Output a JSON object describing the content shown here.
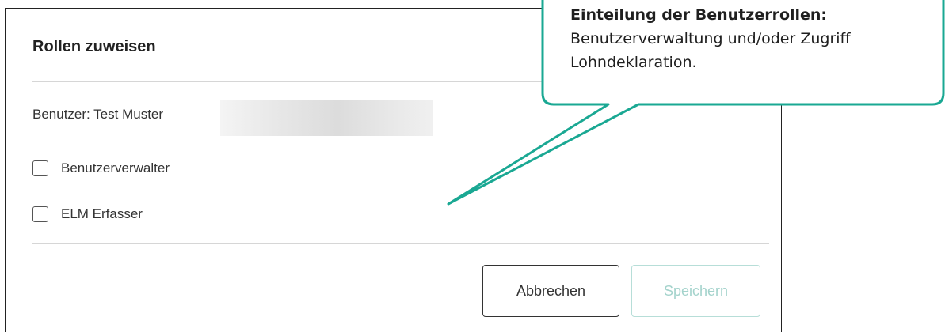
{
  "dialog": {
    "title": "Rollen zuweisen",
    "user_text": "Benutzer: Test Muster",
    "roles": [
      {
        "label": "Benutzerverwalter",
        "checked": false
      },
      {
        "label": "ELM Erfasser",
        "checked": false
      }
    ],
    "cancel_label": "Abbrechen",
    "save_label": "Speichern"
  },
  "callout": {
    "heading": "Einteilung der Benutzerrollen:",
    "line1": "Benutzerverwaltung und/oder Zugriff",
    "line2": "Lohndeklaration.",
    "accent_color": "#1aa893"
  }
}
